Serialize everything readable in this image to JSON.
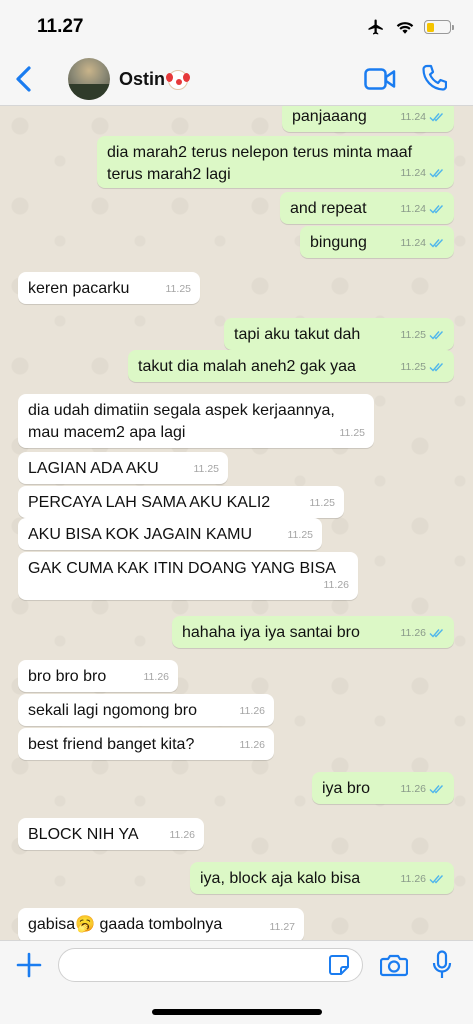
{
  "status_bar": {
    "time": "11.27",
    "battery_level": 0.35
  },
  "header": {
    "contact_name": "Ostin"
  },
  "messages": [
    {
      "dir": "out",
      "text": "panjaaang",
      "time": "11.24"
    },
    {
      "dir": "out",
      "text": "dia marah2 terus nelepon terus minta maaf\nterus marah2 lagi",
      "time": "11.24"
    },
    {
      "dir": "out",
      "text": "and repeat",
      "time": "11.24"
    },
    {
      "dir": "out",
      "text": "bingung",
      "time": "11.24"
    },
    {
      "dir": "in",
      "text": "keren pacarku",
      "time": "11.25"
    },
    {
      "dir": "out",
      "text": "tapi aku takut dah",
      "time": "11.25"
    },
    {
      "dir": "out",
      "text": "takut dia malah aneh2 gak yaa",
      "time": "11.25"
    },
    {
      "dir": "in",
      "text": "dia udah dimatiin segala aspek kerjaannya,\nmau macem2 apa lagi",
      "time": "11.25"
    },
    {
      "dir": "in",
      "text": "LAGIAN ADA AKU",
      "time": "11.25"
    },
    {
      "dir": "in",
      "text": "PERCAYA LAH SAMA AKU KALI2",
      "time": "11.25"
    },
    {
      "dir": "in",
      "text": "AKU BISA KOK JAGAIN KAMU",
      "time": "11.25"
    },
    {
      "dir": "in",
      "text": "GAK CUMA KAK ITIN DOANG YANG BISA",
      "time": "11.26"
    },
    {
      "dir": "out",
      "text": "hahaha iya iya santai bro",
      "time": "11.26"
    },
    {
      "dir": "in",
      "text": "bro bro bro",
      "time": "11.26"
    },
    {
      "dir": "in",
      "text": "sekali lagi ngomong bro",
      "time": "11.26"
    },
    {
      "dir": "in",
      "text": "best friend banget kita?",
      "time": "11.26"
    },
    {
      "dir": "out",
      "text": "iya bro",
      "time": "11.26"
    },
    {
      "dir": "in",
      "text": "BLOCK NIH YA",
      "time": "11.26"
    },
    {
      "dir": "out",
      "text": "iya, block aja kalo bisa",
      "time": "11.26"
    },
    {
      "dir": "in",
      "text": "gabisa🥱 gaada tombolnya",
      "time": "11.27"
    }
  ],
  "colors": {
    "accent": "#1a7cf0",
    "outgoing_bubble": "#dcf8c6",
    "incoming_bubble": "#ffffff",
    "read_tick": "#4fb6ec"
  },
  "icons": [
    "back-chevron",
    "video-call",
    "phone-call",
    "plus",
    "sticker",
    "camera",
    "microphone",
    "airplane",
    "wifi",
    "battery"
  ]
}
